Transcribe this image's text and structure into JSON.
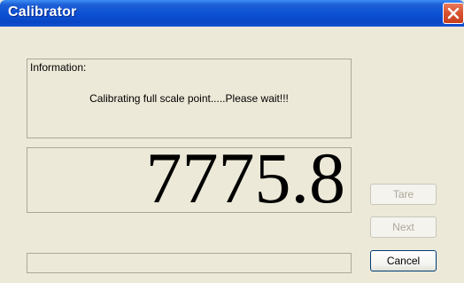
{
  "window": {
    "title": "Calibrator"
  },
  "info": {
    "caption": "Information:",
    "message": "Calibrating full scale point.....Please wait!!!"
  },
  "display": {
    "value": "7775.8"
  },
  "progress": {
    "fraction": 0
  },
  "buttons": {
    "tare": {
      "label": "Tare",
      "enabled": false
    },
    "next": {
      "label": "Next",
      "enabled": false
    },
    "cancel": {
      "label": "Cancel",
      "enabled": true
    }
  },
  "colors": {
    "titlebar": "#0a4fd3",
    "window_bg": "#ece9d8",
    "close_button": "#d8512f",
    "disabled_text": "#aca899"
  },
  "icons": {
    "close": "close-icon"
  }
}
